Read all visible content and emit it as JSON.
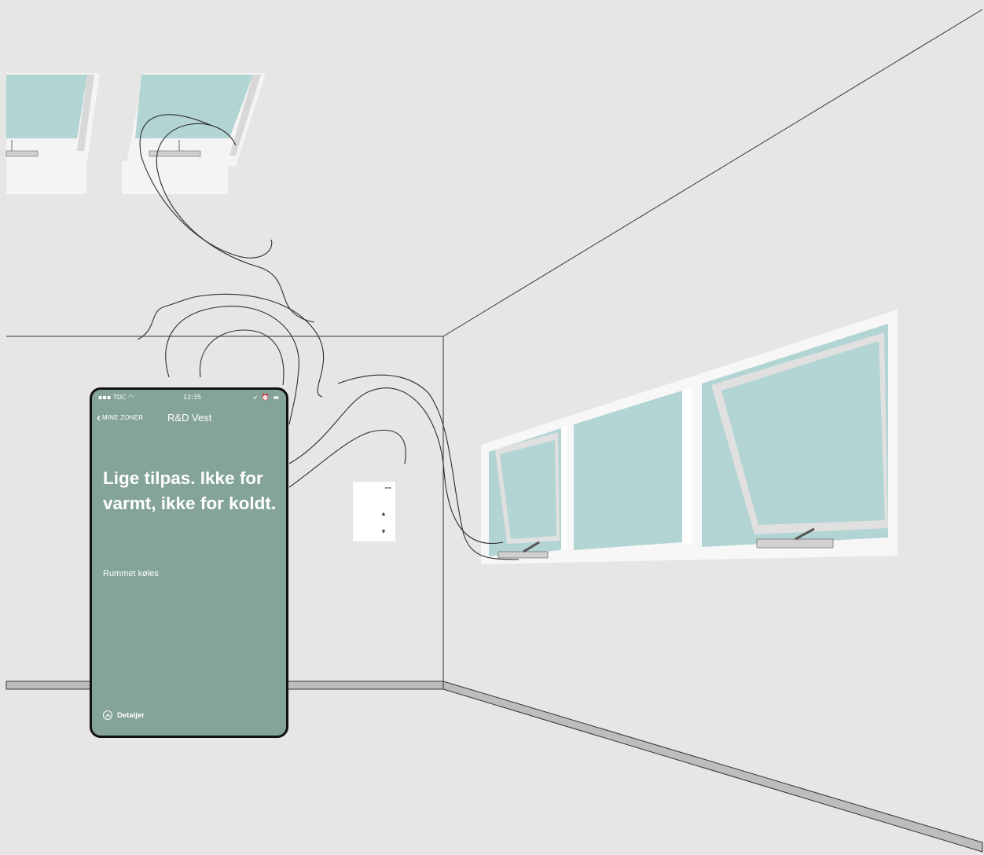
{
  "colors": {
    "wall": "#e6e6e6",
    "glass": "#b2d4d3",
    "phone_screen": "#84a39b",
    "frame": "#111111"
  },
  "phone": {
    "status": {
      "carrier": "TDC",
      "time": "12:35"
    },
    "nav": {
      "back_label": "MINE ZONER",
      "title": "R&D Vest"
    },
    "headline": "Lige tilpas. Ikke for varmt, ikke for koldt.",
    "subtext": "Rummet køles",
    "details_label": "Detaljer"
  },
  "thermostat": {
    "up_icon": "triangle-up-icon",
    "down_icon": "triangle-down-icon"
  }
}
